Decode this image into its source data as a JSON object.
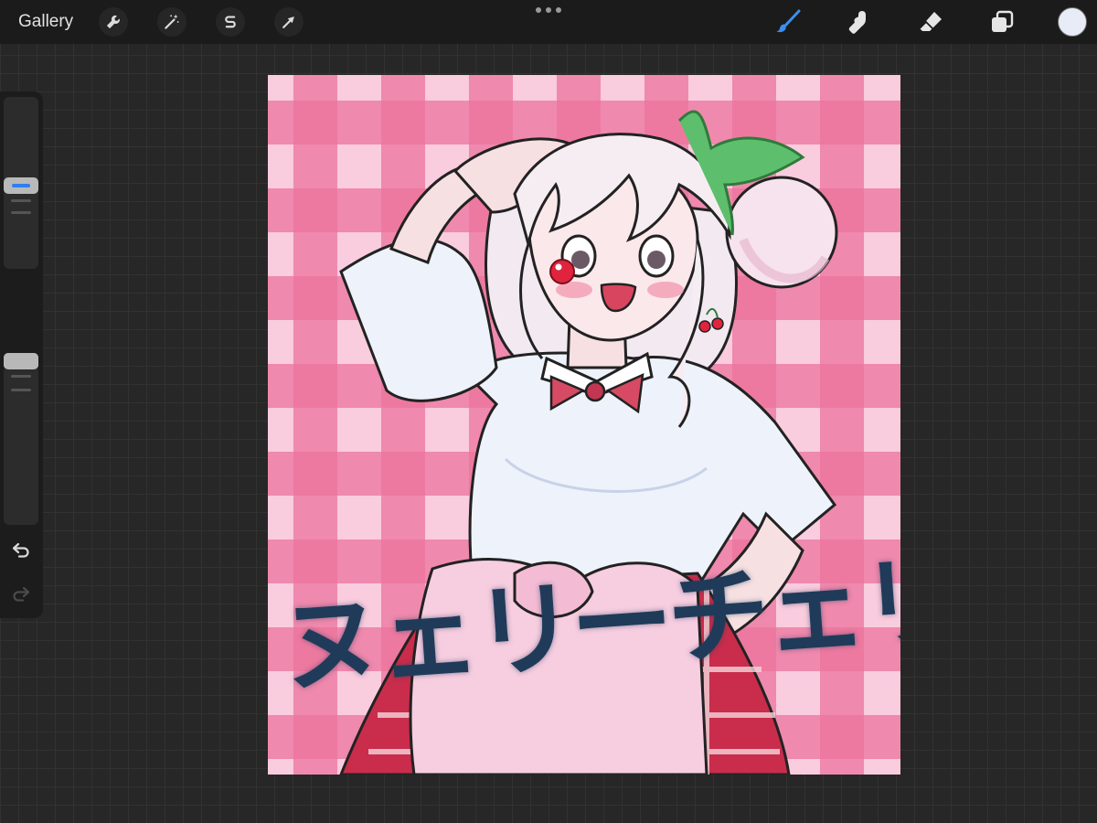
{
  "topbar": {
    "gallery_label": "Gallery",
    "left_tools": [
      {
        "name": "actions",
        "icon": "wrench-icon"
      },
      {
        "name": "adjustments",
        "icon": "magic-wand-icon"
      },
      {
        "name": "selection",
        "icon": "selection-s-icon"
      },
      {
        "name": "transform",
        "icon": "arrow-cursor-icon"
      }
    ],
    "more_icon": "more-dots-icon",
    "right_tools": [
      {
        "name": "brush",
        "icon": "brush-icon",
        "active": true,
        "active_color": "#3b8ef0"
      },
      {
        "name": "smudge",
        "icon": "smudge-finger-icon"
      },
      {
        "name": "eraser",
        "icon": "eraser-icon"
      },
      {
        "name": "layers",
        "icon": "layers-icon"
      }
    ],
    "current_color": "#e8ecf6"
  },
  "sidebar": {
    "brush_size_handle_color": "#2f7ff0",
    "opacity_handle_color": "#b8b8b8",
    "modify_icon": "square-modify-icon",
    "undo_icon": "undo-arrow-icon",
    "redo_icon": "redo-arrow-icon"
  },
  "canvas": {
    "caption_text": "ヌェリーチェリー",
    "caption_color": "#1f3b59",
    "background_pattern": "pink gingham",
    "pattern_colors": [
      "#f8c8dc",
      "#e85c8c"
    ]
  }
}
